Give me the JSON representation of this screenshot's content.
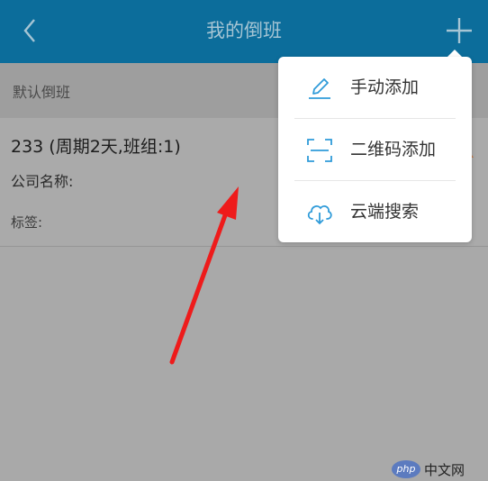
{
  "header": {
    "title": "我的倒班",
    "back_icon": "chevron-left-icon",
    "add_icon": "plus-icon",
    "color": "#0c6d9b"
  },
  "section": {
    "label": "默认倒班"
  },
  "card": {
    "title": "233 (周期2天,班组:1)",
    "company_label": "公司名称:",
    "tags_label": "标签:"
  },
  "menu": {
    "items": [
      {
        "label": "手动添加",
        "icon": "pencil-icon"
      },
      {
        "label": "二维码添加",
        "icon": "qr-scan-icon"
      },
      {
        "label": "云端搜索",
        "icon": "cloud-download-icon"
      }
    ],
    "icon_color": "#2f9bd9"
  },
  "watermark": {
    "badge": "php",
    "text": "中文网"
  }
}
